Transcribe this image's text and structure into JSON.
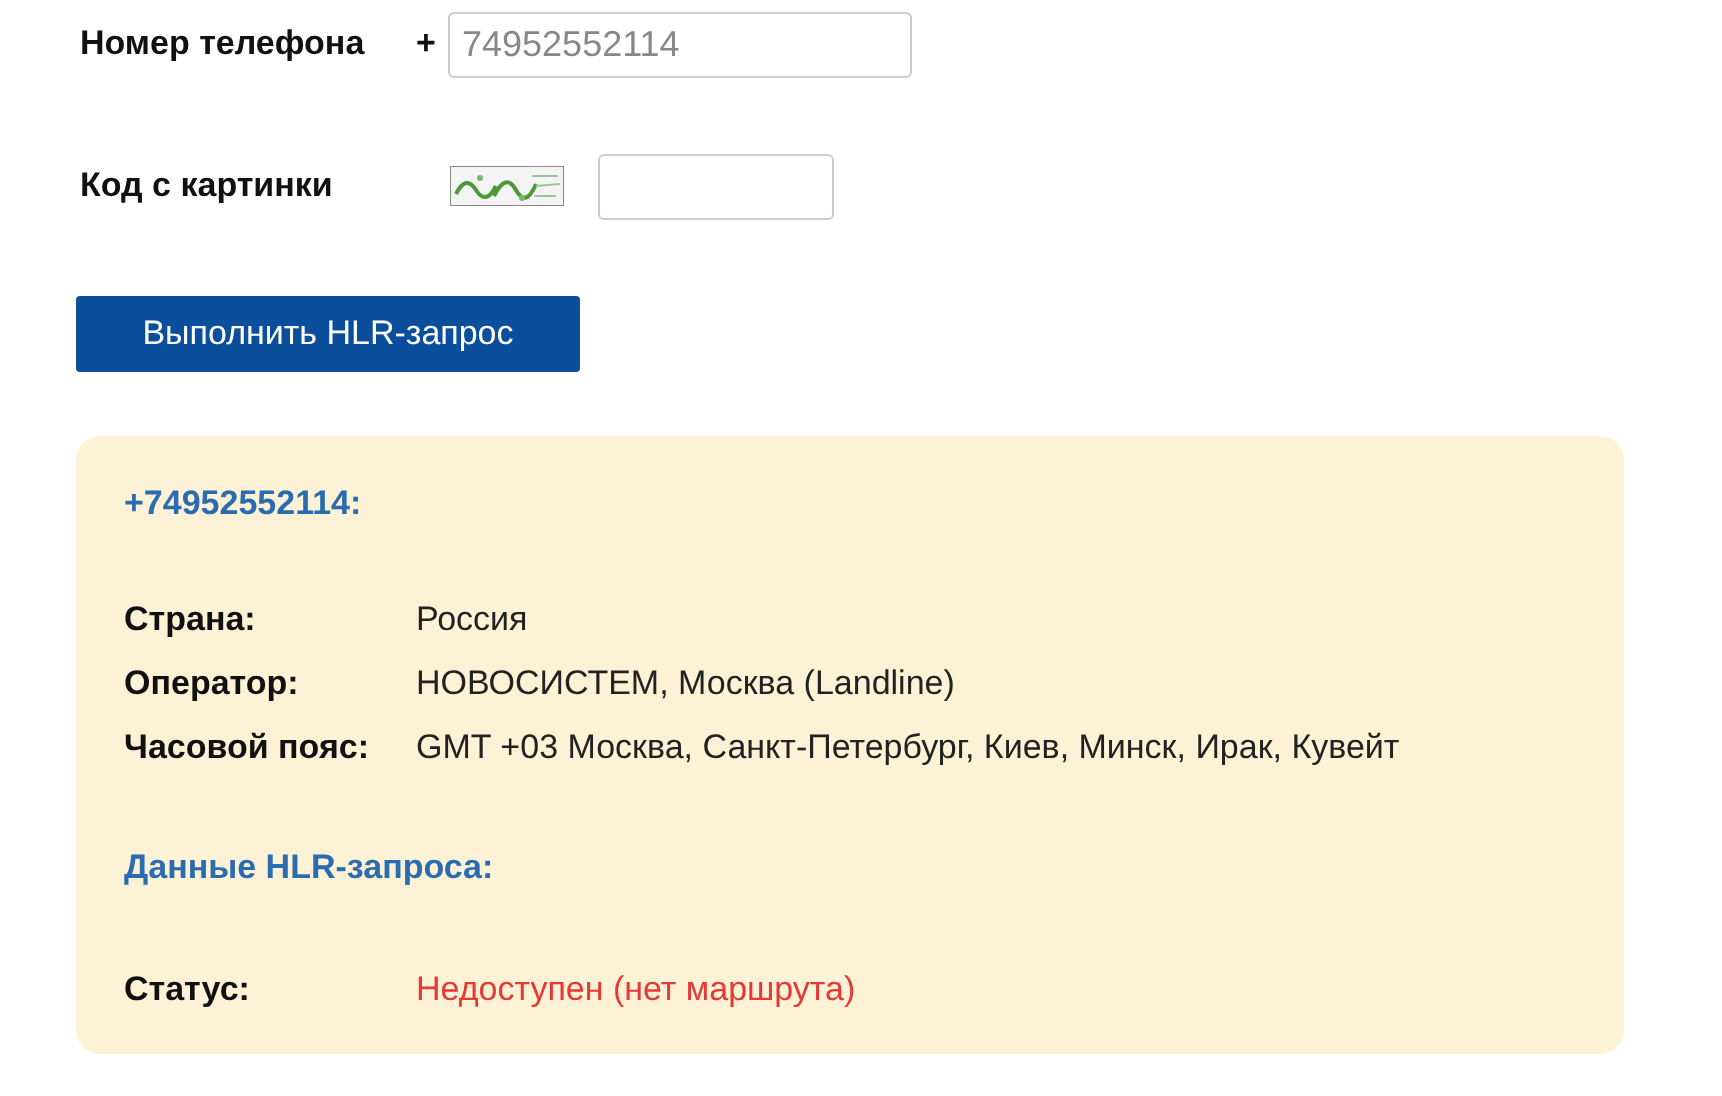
{
  "phone_field": {
    "label": "Номер телефона",
    "prefix": "+",
    "placeholder": "74952552114"
  },
  "captcha_field": {
    "label": "Код с картинки"
  },
  "submit_button": "Выполнить HLR-запрос",
  "result": {
    "title": "+74952552114:",
    "info_rows": [
      {
        "label": "Страна:",
        "value": "Россия",
        "kind": "normal"
      },
      {
        "label": "Оператор:",
        "value": "НОВОСИСТЕМ, Москва (Landline)",
        "kind": "normal"
      },
      {
        "label": "Часовой пояс:",
        "value": "GMT +03 Москва, Санкт-Петербург, Киев, Минск, Ирак, Кувейт",
        "kind": "normal"
      }
    ],
    "hlr_heading": "Данные HLR-запроса:",
    "hlr_rows": [
      {
        "label": "Статус:",
        "value": "Недоступен (нет маршрута)",
        "kind": "error"
      }
    ]
  }
}
